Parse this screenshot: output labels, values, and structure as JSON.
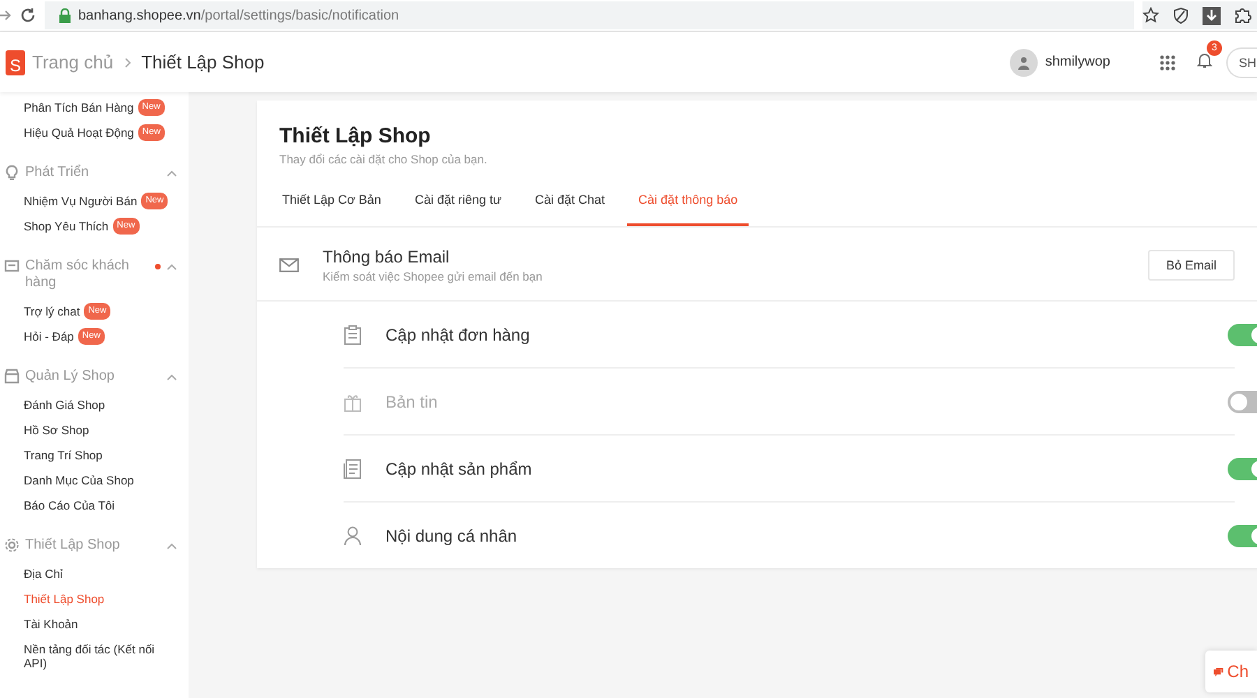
{
  "browser": {
    "url_host": "banhang.shopee.vn",
    "url_path": "/portal/settings/basic/notification"
  },
  "header": {
    "logo_letter": "S",
    "breadcrumb": [
      {
        "label": "Trang chủ"
      },
      {
        "label": "Thiết Lập Shop"
      }
    ],
    "username": "shmilywop",
    "notification_count": "3",
    "shop_button": "SH"
  },
  "sidebar": {
    "sections": [
      {
        "items": [
          {
            "label": "Phân Tích Bán Hàng",
            "badge": "New",
            "selected": false
          },
          {
            "label": "Hiệu Quả Hoạt Động",
            "badge": "New",
            "selected": false
          }
        ]
      },
      {
        "title": "Phát Triển",
        "expanded": true,
        "dot": false,
        "items": [
          {
            "label": "Nhiệm Vụ Người Bán",
            "badge": "New",
            "selected": false
          },
          {
            "label": "Shop Yêu Thích",
            "badge": "New",
            "selected": false
          }
        ]
      },
      {
        "title": "Chăm sóc khách hàng",
        "expanded": true,
        "dot": true,
        "items": [
          {
            "label": "Trợ lý chat",
            "badge": "New",
            "selected": false
          },
          {
            "label": "Hỏi - Đáp",
            "badge": "New",
            "selected": false
          }
        ]
      },
      {
        "title": "Quản Lý Shop",
        "expanded": true,
        "dot": false,
        "items": [
          {
            "label": "Đánh Giá Shop",
            "selected": false
          },
          {
            "label": "Hồ Sơ Shop",
            "selected": false
          },
          {
            "label": "Trang Trí Shop",
            "selected": false
          },
          {
            "label": "Danh Mục Của Shop",
            "selected": false
          },
          {
            "label": "Báo Cáo Của Tôi",
            "selected": false
          }
        ]
      },
      {
        "title": "Thiết Lập Shop",
        "expanded": true,
        "dot": false,
        "items": [
          {
            "label": "Địa Chỉ",
            "selected": false
          },
          {
            "label": "Thiết Lập Shop",
            "selected": true
          },
          {
            "label": "Tài Khoản",
            "selected": false
          },
          {
            "label": "Nền tảng đối tác (Kết nối API)",
            "selected": false
          }
        ]
      }
    ]
  },
  "page": {
    "title": "Thiết Lập Shop",
    "subtitle": "Thay đổi các cài đặt cho Shop của bạn.",
    "tabs": [
      {
        "label": "Thiết Lập Cơ Bản",
        "selected": false
      },
      {
        "label": "Cài đặt riêng tư",
        "selected": false
      },
      {
        "label": "Cài đặt Chat",
        "selected": false
      },
      {
        "label": "Cài đặt thông báo",
        "selected": true
      }
    ],
    "email": {
      "title": "Thông báo Email",
      "description": "Kiểm soát việc Shopee gửi email đến bạn",
      "button": "Bỏ Email"
    },
    "settings": [
      {
        "label": "Cập nhật đơn hàng",
        "on": true
      },
      {
        "label": "Bản tin",
        "on": false
      },
      {
        "label": "Cập nhật sản phẩm",
        "on": true
      },
      {
        "label": "Nội dung cá nhân",
        "on": true
      }
    ]
  },
  "chat_button": {
    "label": "Ch"
  }
}
